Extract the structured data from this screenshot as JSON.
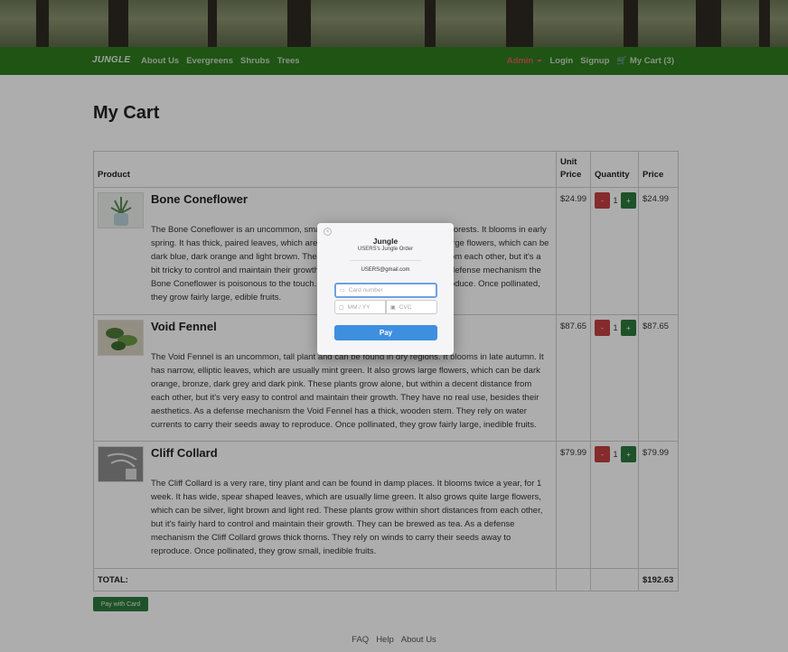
{
  "nav": {
    "brand": "JUNGLE",
    "left": [
      "About Us",
      "Evergreens",
      "Shrubs",
      "Trees"
    ],
    "admin": "Admin",
    "right": [
      "Login",
      "Signup"
    ],
    "cart": "My Cart (3)"
  },
  "page_title": "My Cart",
  "table": {
    "headers": {
      "product": "Product",
      "unit_price_1": "Unit",
      "unit_price_2": "Price",
      "quantity": "Quantity",
      "price": "Price"
    },
    "rows": [
      {
        "name": "Bone Coneflower",
        "description": "The Bone Coneflower is an uncommon, small plant and can be found in dense forests. It blooms in early spring. It has thick, paired leaves, which are usually dark green. It also grows large flowers, which can be dark blue, dark orange and light brown. These plants grow in small distances from each other, but it's a bit tricky to control and maintain their growth. They have unusual sounds. As a defense mechanism the Bone Coneflower is poisonous to the touch. They rely on self pollination to reproduce. Once pollinated, they grow fairly large, edible fruits.",
        "unit_price": "$24.99",
        "quantity": "1",
        "price": "$24.99",
        "minus": "-",
        "plus": "+"
      },
      {
        "name": "Void Fennel",
        "description": "The Void Fennel is an uncommon, tall plant and can be found in dry regions. It blooms in late autumn. It has narrow, elliptic leaves, which are usually mint green. It also grows large flowers, which can be dark orange, bronze, dark grey and dark pink. These plants grow alone, but within a decent distance from each other, but it's very easy to control and maintain their growth. They have no real use, besides their aesthetics. As a defense mechanism the Void Fennel has a thick, wooden stem. They rely on water currents to carry their seeds away to reproduce. Once pollinated, they grow fairly large, inedible fruits.",
        "unit_price": "$87.65",
        "quantity": "1",
        "price": "$87.65",
        "minus": "-",
        "plus": "+"
      },
      {
        "name": "Cliff Collard",
        "description": "The Cliff Collard is a very rare, tiny plant and can be found in damp places. It blooms twice a year, for 1 week. It has wide, spear shaped leaves, which are usually lime green. It also grows quite large flowers, which can be silver, light brown and light red. These plants grow within short distances from each other, but it's fairly hard to control and maintain their growth. They can be brewed as tea. As a defense mechanism the Cliff Collard grows thick thorns. They rely on winds to carry their seeds away to reproduce. Once pollinated, they grow small, inedible fruits.",
        "unit_price": "$79.99",
        "quantity": "1",
        "price": "$79.99",
        "minus": "-",
        "plus": "+"
      }
    ],
    "total_label": "TOTAL:",
    "total_value": "$192.63"
  },
  "pay_button": "Pay with Card",
  "footer": [
    "FAQ",
    "Help",
    "About Us"
  ],
  "checkout": {
    "title": "Jungle",
    "subtitle": "USERS's Jungle Order",
    "email": "USERS@gmail.com",
    "card_placeholder": "Card number",
    "expiry_placeholder": "MM / YY",
    "cvc_placeholder": "CVC",
    "pay_label": "Pay",
    "close": "×"
  },
  "colors": {
    "navbar": "#2f7d1f",
    "admin": "#e45a5a",
    "pay": "#3e8fdf",
    "minus": "#c44040",
    "plus": "#2d7a3d"
  }
}
